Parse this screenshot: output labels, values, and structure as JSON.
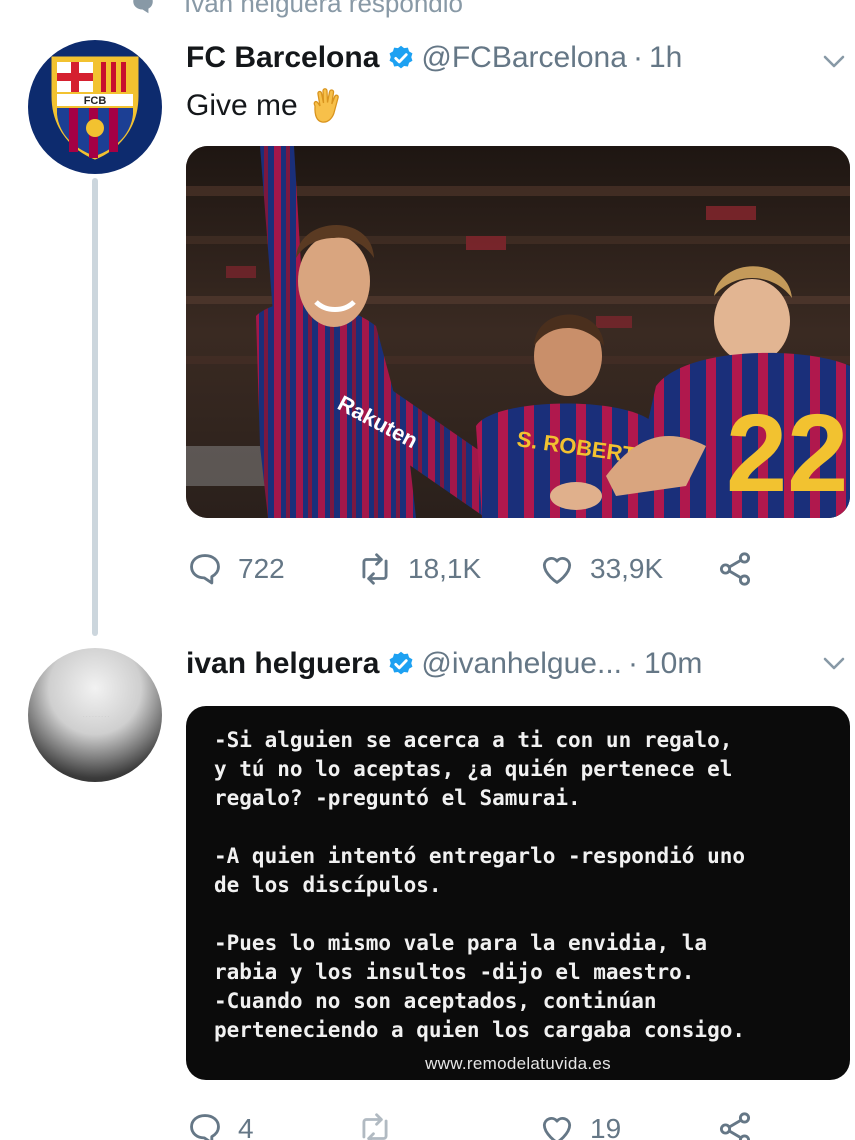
{
  "context": {
    "text": "Ivan helguera respondió"
  },
  "tweet1": {
    "name": "FC Barcelona",
    "handle": "@FCBarcelona",
    "separator": "·",
    "time": "1h",
    "text": "Give me",
    "emoji": "raised-hand",
    "media": {
      "shirt_texts": [
        "Rakuten",
        "S. ROBERTO",
        "22"
      ],
      "crest_letters": "FCB"
    },
    "actions": {
      "replies": "722",
      "retweets": "18,1K",
      "likes": "33,9K"
    }
  },
  "tweet2": {
    "name": "ivan helguera",
    "handle": "@ivanhelgue...",
    "separator": "·",
    "time": "10m",
    "quote_text": "-Si alguien se acerca a ti con un regalo,\ny tú no lo aceptas, ¿a quién pertenece el\nregalo? -preguntó el Samurai.\n\n-A quien intentó entregarlo -respondió uno\nde los discípulos.\n\n-Pues lo mismo vale para la envidia, la\nrabia y los insultos -dijo el maestro.\n-Cuando no son aceptados, continúan\nperteneciendo a quien los cargaba consigo.",
    "quote_footer": "www.remodelatuvida.es",
    "actions": {
      "replies": "4",
      "likes": "19"
    }
  },
  "colors": {
    "verified": "#1da1f2",
    "icon_gray": "#657786",
    "thread_line": "#ccd6dd"
  }
}
